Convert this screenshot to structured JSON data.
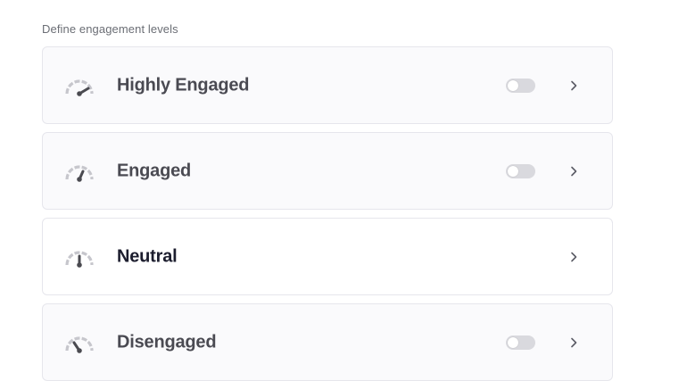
{
  "section": {
    "title": "Define engagement levels"
  },
  "levels": [
    {
      "name": "Highly Engaged",
      "icon": "gauge-high-icon",
      "toggle_visible": true,
      "toggle_on": false
    },
    {
      "name": "Engaged",
      "icon": "gauge-medium-icon",
      "toggle_visible": true,
      "toggle_on": false
    },
    {
      "name": "Neutral",
      "icon": "gauge-neutral-icon",
      "toggle_visible": false,
      "toggle_on": false
    },
    {
      "name": "Disengaged",
      "icon": "gauge-low-icon",
      "toggle_visible": true,
      "toggle_on": false
    }
  ],
  "colors": {
    "gauge_arc": "#c6c6cc",
    "gauge_needle": "#4a4a50",
    "title_text": "#1c1d2e",
    "muted_text": "#6b6e75",
    "toggle_off": "#d9d9de"
  }
}
